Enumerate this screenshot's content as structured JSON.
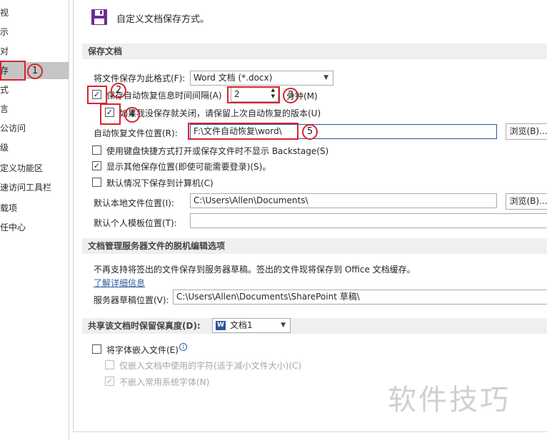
{
  "sidebar": {
    "items": [
      {
        "label": "视"
      },
      {
        "label": "示"
      },
      {
        "label": "对"
      },
      {
        "label": "存"
      },
      {
        "label": "式"
      },
      {
        "label": "言"
      },
      {
        "label": "公访问"
      },
      {
        "label": "级"
      },
      {
        "label": "定义功能区"
      },
      {
        "label": "速访问工具栏"
      },
      {
        "label": "载项"
      },
      {
        "label": "任中心"
      }
    ],
    "selected_index": 3
  },
  "header": {
    "title": "自定义文档保存方式。"
  },
  "save_section": {
    "heading": "保存文档",
    "format_label": "将文件保存为此格式(F):",
    "format_value": "Word 文档 (*.docx)",
    "autorecover_label": "保存自动恢复信息时间间隔(A)",
    "autorecover_minutes": "2",
    "minutes_label": "分钟(M)",
    "keep_last_label": "如果我没保存就关闭，请保留上次自动恢复的版本(U)",
    "autorecover_location_label": "自动恢复文件位置(R):",
    "autorecover_location_value": "F:\\文件自动恢复\\word\\",
    "browse_label": "浏览(B)...",
    "hide_backstage_label": "使用键盘快捷方式打开或保存文件时不显示 Backstage(S)",
    "show_additional_label": "显示其他保存位置(即使可能需要登录)(S)。",
    "save_to_computer_label": "默认情况下保存到计算机(C)",
    "default_local_label": "默认本地文件位置(I):",
    "default_local_value": "C:\\Users\\Allen\\Documents\\",
    "browse2_label": "浏览(B)...",
    "default_template_label": "默认个人模板位置(T):",
    "default_template_value": ""
  },
  "offline_section": {
    "heading": "文档管理服务器文件的脱机编辑选项",
    "info": "不再支持将签出的文件保存到服务器草稿。签出的文件现将保存到 Office 文档缓存。",
    "learn_more": "了解详细信息",
    "drafts_label": "服务器草稿位置(V):",
    "drafts_value": "C:\\Users\\Allen\\Documents\\SharePoint 草稿\\"
  },
  "fidelity_section": {
    "heading": "共享该文档时保留保真度(D):",
    "doc_value": "文档1",
    "embed_fonts_label": "将字体嵌入文件(E)",
    "embed_used_chars_label": "仅嵌入文档中使用的字符(适于减小文件大小)(C)",
    "no_common_fonts_label": "不嵌入常用系统字体(N)"
  },
  "annotations": [
    "1",
    "2",
    "3",
    "4",
    "5"
  ],
  "watermark": "软件技巧",
  "colors": {
    "annotation_red": "#d9232d",
    "selected_nav": "#c5c5c5",
    "section_bg": "#efefef",
    "icon_purple": "#6b2c91"
  }
}
